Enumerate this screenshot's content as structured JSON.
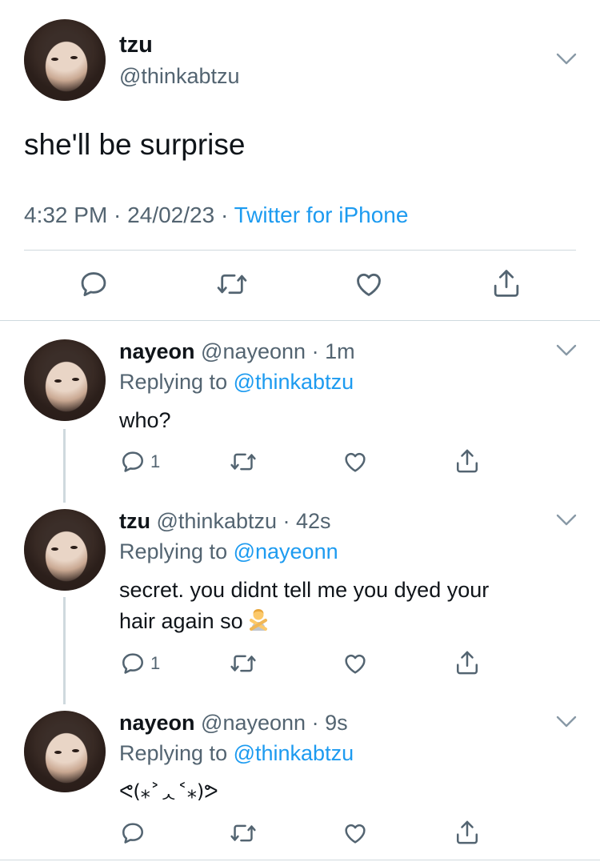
{
  "main_tweet": {
    "name": "tzu",
    "handle": "@thinkabtzu",
    "text": "she'll be surprise",
    "time": "4:32 PM",
    "date": "24/02/23",
    "source": "Twitter for iPhone",
    "sep": " · "
  },
  "replies": [
    {
      "name": "nayeon",
      "handle": "@nayeonn",
      "age": "· 1m",
      "replying_prefix": "Replying to ",
      "replying_to": "@thinkabtzu",
      "text": "who?",
      "reply_count": "1"
    },
    {
      "name": "tzu",
      "handle": "@thinkabtzu",
      "age": "· 42s",
      "replying_prefix": "Replying to ",
      "replying_to": "@nayeonn",
      "text_line1": "secret. you didnt tell me you dyed your",
      "text_line2": "hair again so",
      "emoji": "person-gesturing-no-emoji",
      "reply_count": "1"
    },
    {
      "name": "nayeon",
      "handle": "@nayeonn",
      "age": "· 9s",
      "replying_prefix": "Replying to ",
      "replying_to": "@thinkabtzu",
      "text": "ᕙ(⁎˃ᆺ˂⁎)ᕗ",
      "reply_count": ""
    }
  ],
  "colors": {
    "accent": "#1d9bf0",
    "secondary": "#536471",
    "divider": "#cfd9de"
  },
  "icons": [
    "reply-icon",
    "retweet-icon",
    "like-icon",
    "share-icon",
    "chevron-down-icon"
  ]
}
